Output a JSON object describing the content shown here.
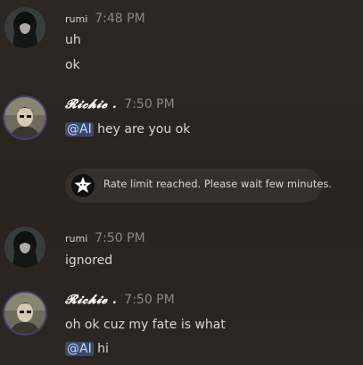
{
  "messages": [
    {
      "author": "rumi",
      "avatar_icon": "dark-haired-avatar-icon",
      "time": "7:48 PM",
      "lines": [
        "uh",
        "ok"
      ]
    },
    {
      "author": "𝓡𝓲𝓬𝓱𝓲𝓮 .",
      "avatar_icon": "richie-avatar-icon",
      "time": "7:50 PM",
      "mention": "@AI",
      "text": "hey are you ok"
    },
    {
      "author": "rumi",
      "avatar_icon": "dark-haired-avatar-icon",
      "time": "7:50 PM",
      "lines": [
        "ignored"
      ]
    },
    {
      "author": "𝓡𝓲𝓬𝓱𝓲𝓮 .",
      "avatar_icon": "richie-avatar-icon",
      "time": "7:50 PM",
      "lines": [
        "oh ok cuz my fate is what"
      ],
      "mention": "@AI",
      "text": "hi"
    }
  ],
  "system_notice": {
    "icon": "star-bot-icon",
    "text": "Rate limit reached. Please wait few minutes."
  },
  "colors": {
    "background": "#2b2521",
    "mention_bg": "#3b4a6b",
    "mention_fg": "#c9d6ff",
    "timestamp": "#8e8782"
  }
}
